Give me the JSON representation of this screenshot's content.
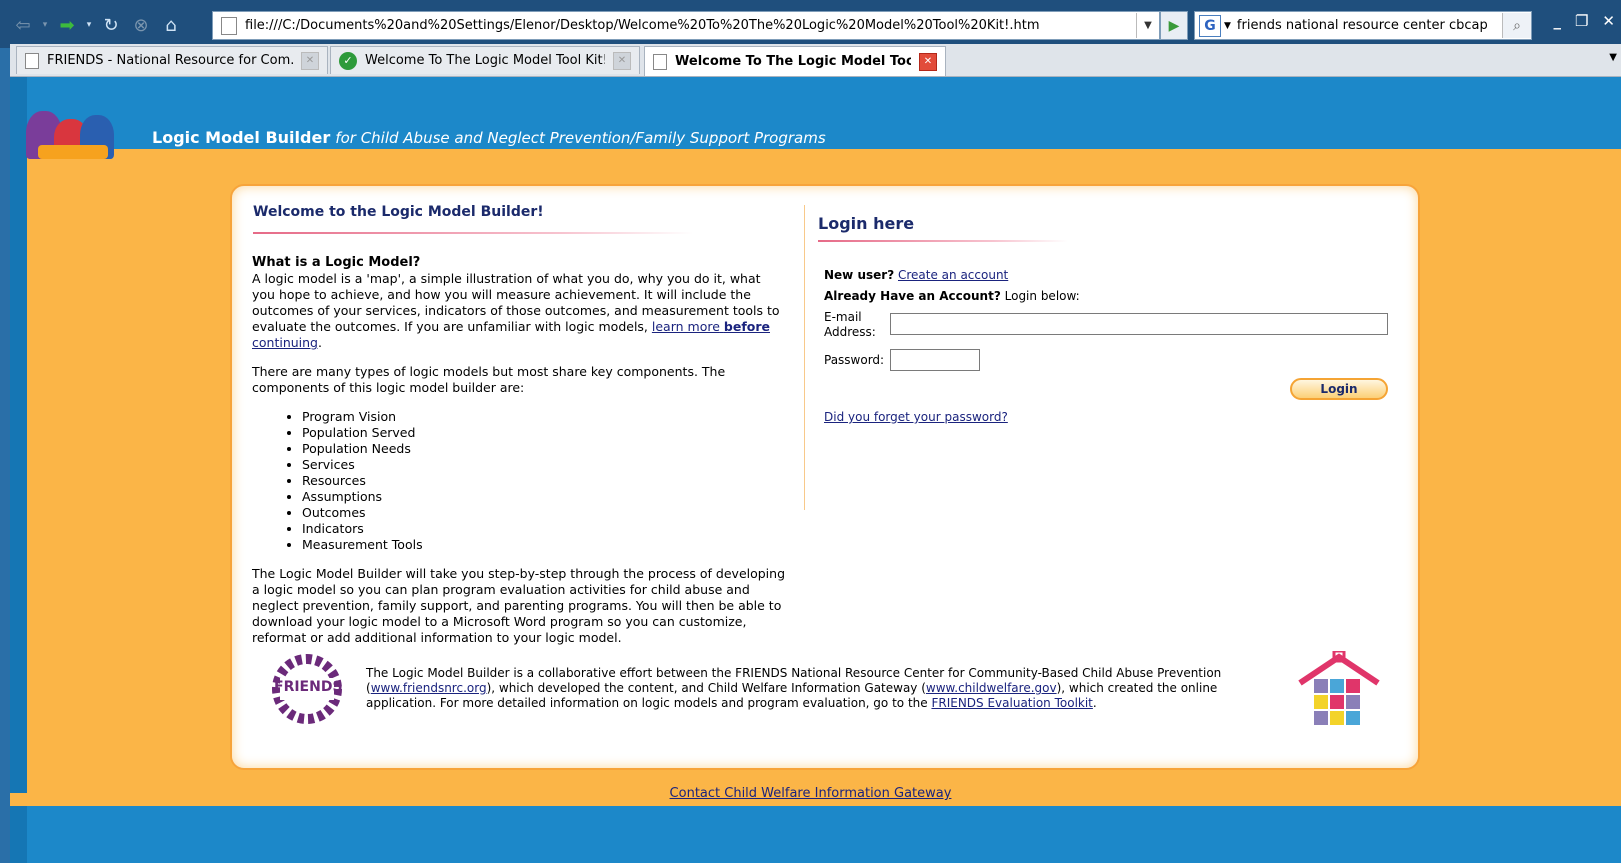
{
  "browser": {
    "url": "file:///C:/Documents%20and%20Settings/Elenor/Desktop/Welcome%20To%20The%20Logic%20Model%20Tool%20Kit!.htm",
    "search_query": "friends national resource center cbcap",
    "search_engine_glyph": "G",
    "tabs": [
      {
        "label": "FRIENDS - National Resource for Com...",
        "icon": "page-icon",
        "active": false
      },
      {
        "label": "Welcome To The Logic Model Tool Kit!",
        "icon": "green-check-icon",
        "active": false
      },
      {
        "label": "Welcome To The Logic Model Too...",
        "icon": "page-icon",
        "active": true
      }
    ],
    "window_controls": [
      "_",
      "❐",
      "✕"
    ]
  },
  "site": {
    "title_bold": "Logic Model Builder",
    "title_italic": "for Child Abuse and Neglect Prevention/Family Support Programs"
  },
  "welcome": {
    "heading": "Welcome to the Logic Model Builder!",
    "question": "What is a Logic Model?",
    "intro_text": "A logic model is a 'map', a simple illustration of what you do, why you do it, what you hope to achieve, and how you will measure achievement. It will include the outcomes of your services, indicators of those outcomes, and measurement tools to evaluate the outcomes. If you are unfamiliar with logic models, ",
    "learn_more_link": "learn more",
    "before_bold": "before",
    "continuing_link": "continuing",
    "components_intro": "There are many types of logic models but most share key components. The components of this logic model builder are:",
    "components": [
      "Program Vision",
      "Population Served",
      "Population Needs",
      "Services",
      "Resources",
      "Assumptions",
      "Outcomes",
      "Indicators",
      "Measurement Tools"
    ],
    "closing_text": "The Logic Model Builder will take you step-by-step through the process of developing a logic model so you can plan program evaluation activities for child abuse and neglect prevention, family support, and parenting programs. You will then be able to download your logic model to a Microsoft Word program so you can customize, reformat or add additional information to your logic model."
  },
  "login": {
    "heading": "Login here",
    "new_user_label": "New user?",
    "create_account_link": "Create an account",
    "have_account_label": "Already Have an Account?",
    "login_below": "Login below:",
    "email_label_1": "E-mail",
    "email_label_2": "Address:",
    "email_value": "",
    "password_label": "Password:",
    "password_value": "",
    "login_button": "Login",
    "forgot_link": "Did you forget your password?"
  },
  "footer": {
    "text_1": "The Logic Model Builder is a collaborative effort between the FRIENDS National Resource Center for Community-Based Child Abuse Prevention (",
    "friends_link": "www.friendsnrc.org",
    "text_2": "), which developed the content, and Child Welfare Information Gateway (",
    "cwig_link": "www.childwelfare.gov",
    "text_3": "), which created the online application. For more detailed information on logic models and program evaluation, go to the ",
    "toolkit_link": "FRIENDS Evaluation Toolkit",
    "text_4": ".",
    "friends_logo_text": "FRIENDS",
    "contact_link": "Contact Child Welfare Information Gateway"
  },
  "colors": {
    "page_blue": "#1c88c9",
    "page_orange": "#fbb547",
    "heading_navy": "#1b2a6b"
  }
}
